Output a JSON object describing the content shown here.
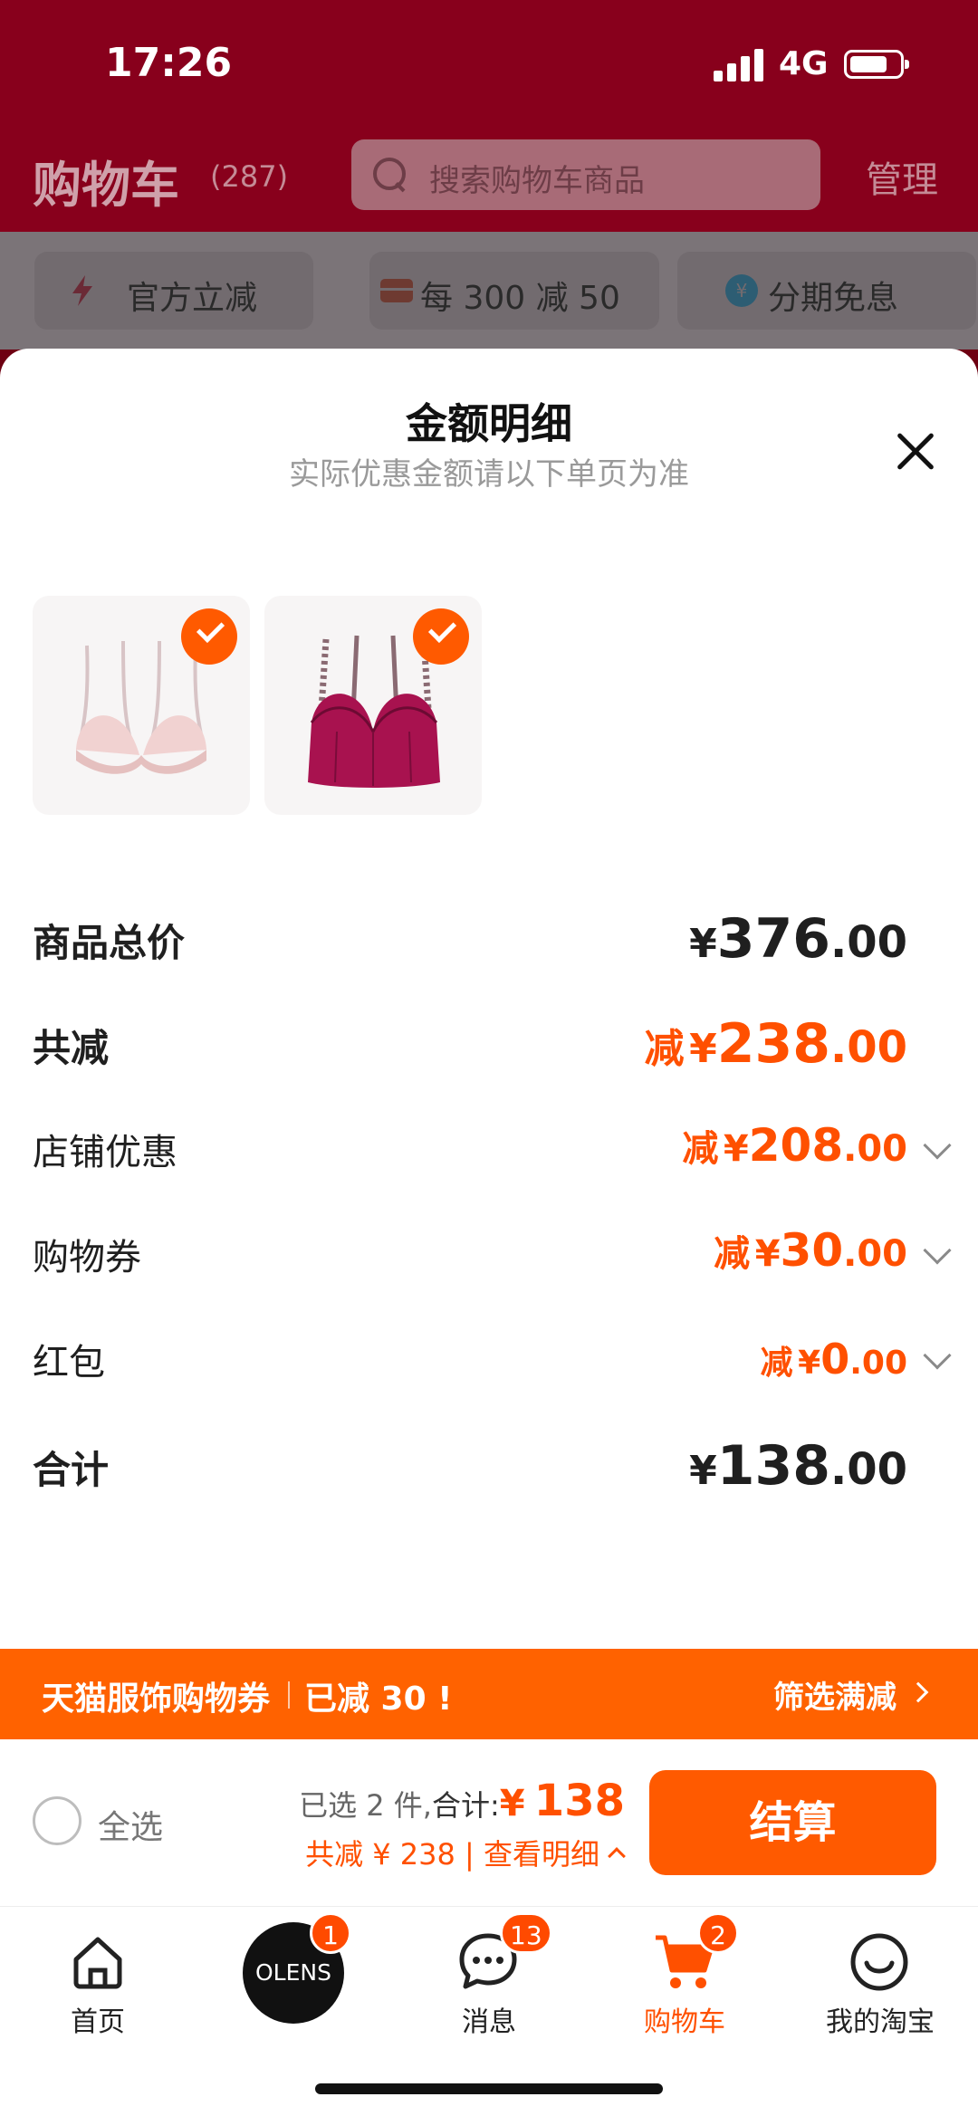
{
  "status_bar": {
    "time": "17:26",
    "network": "4G"
  },
  "header": {
    "title": "购物车",
    "count": "(287)",
    "search_placeholder": "搜索购物车商品",
    "manage": "管理"
  },
  "filters": [
    {
      "label": "官方立减",
      "icon": "lightning-icon"
    },
    {
      "label": "每 300 减 50",
      "icon": "coupon-icon"
    },
    {
      "label": "分期免息",
      "icon": "installment-icon"
    }
  ],
  "sheet": {
    "title": "金额明细",
    "subtitle": "实际优惠金额请以下单页为准",
    "products": [
      {
        "name": "pink-bra",
        "selected": true
      },
      {
        "name": "burgundy-bra",
        "selected": true
      }
    ],
    "rows": {
      "total_price": {
        "label": "商品总价",
        "currency": "¥",
        "int": "376",
        "dec": ".00"
      },
      "total_discount": {
        "label": "共减",
        "prefix": "减",
        "currency": "¥",
        "int": "238",
        "dec": ".00"
      },
      "store_discount": {
        "label": "店铺优惠",
        "prefix": "减",
        "currency": "¥",
        "int": "208",
        "dec": ".00"
      },
      "coupon": {
        "label": "购物券",
        "prefix": "减",
        "currency": "¥",
        "int": "30",
        "dec": ".00"
      },
      "red_packet": {
        "label": "红包",
        "prefix": "减",
        "currency": "¥",
        "int": "0",
        "dec": ".00"
      },
      "final": {
        "label": "合计",
        "currency": "¥",
        "int": "138",
        "dec": ".00"
      }
    }
  },
  "promo": {
    "left": "天猫服饰购物券",
    "left2": "已减 30 !",
    "right": "筛选满减"
  },
  "checkout": {
    "select_all": "全选",
    "selected": "已选 2 件,",
    "total_label": "合计:",
    "currency": "¥",
    "amount": "138",
    "discount": "共减 ¥ 238",
    "details": "查看明细",
    "pay": "结算"
  },
  "tabs": [
    {
      "label": "首页",
      "icon": "home-icon"
    },
    {
      "label": "OLENS",
      "icon": "olens-logo",
      "badge": "1"
    },
    {
      "label": "消息",
      "icon": "message-icon",
      "badge": "13"
    },
    {
      "label": "购物车",
      "icon": "cart-icon",
      "badge": "2",
      "active": true
    },
    {
      "label": "我的淘宝",
      "icon": "profile-icon"
    }
  ],
  "colors": {
    "accent": "#ff5000",
    "header_bg": "#88001c"
  }
}
